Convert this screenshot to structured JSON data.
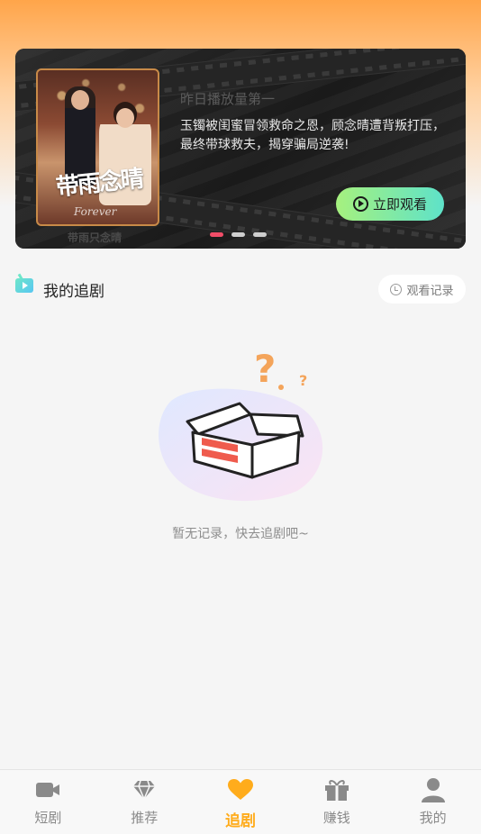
{
  "banner": {
    "rank_label": "昨日播放量第一",
    "poster_title": "带雨念晴",
    "poster_subtitle": "Forever",
    "poster_caption": "带雨只念晴",
    "description": "玉镯被闺蜜冒领救命之恩，顾念晴遭背叛打压，最终带球救夫，揭穿骗局逆袭!",
    "watch_button_label": "立即观看",
    "carousel_dots": 3,
    "active_dot": 0
  },
  "section": {
    "title": "我的追剧",
    "history_label": "观看记录"
  },
  "empty_state": {
    "message": "暂无记录，快去追剧吧~"
  },
  "tabbar": {
    "tabs": [
      {
        "label": "短剧",
        "icon": "video-camera-icon",
        "active": false
      },
      {
        "label": "推荐",
        "icon": "diamond-icon",
        "active": false
      },
      {
        "label": "追剧",
        "icon": "heart-icon",
        "active": true
      },
      {
        "label": "赚钱",
        "icon": "gift-icon",
        "active": false
      },
      {
        "label": "我的",
        "icon": "user-icon",
        "active": false
      }
    ]
  },
  "colors": {
    "header_gradient_top": "#ffa54a",
    "accent_active": "#ffac1c",
    "watch_button_start": "#a6f17e",
    "watch_button_end": "#5ee2c9",
    "active_dot": "#f14d68"
  }
}
